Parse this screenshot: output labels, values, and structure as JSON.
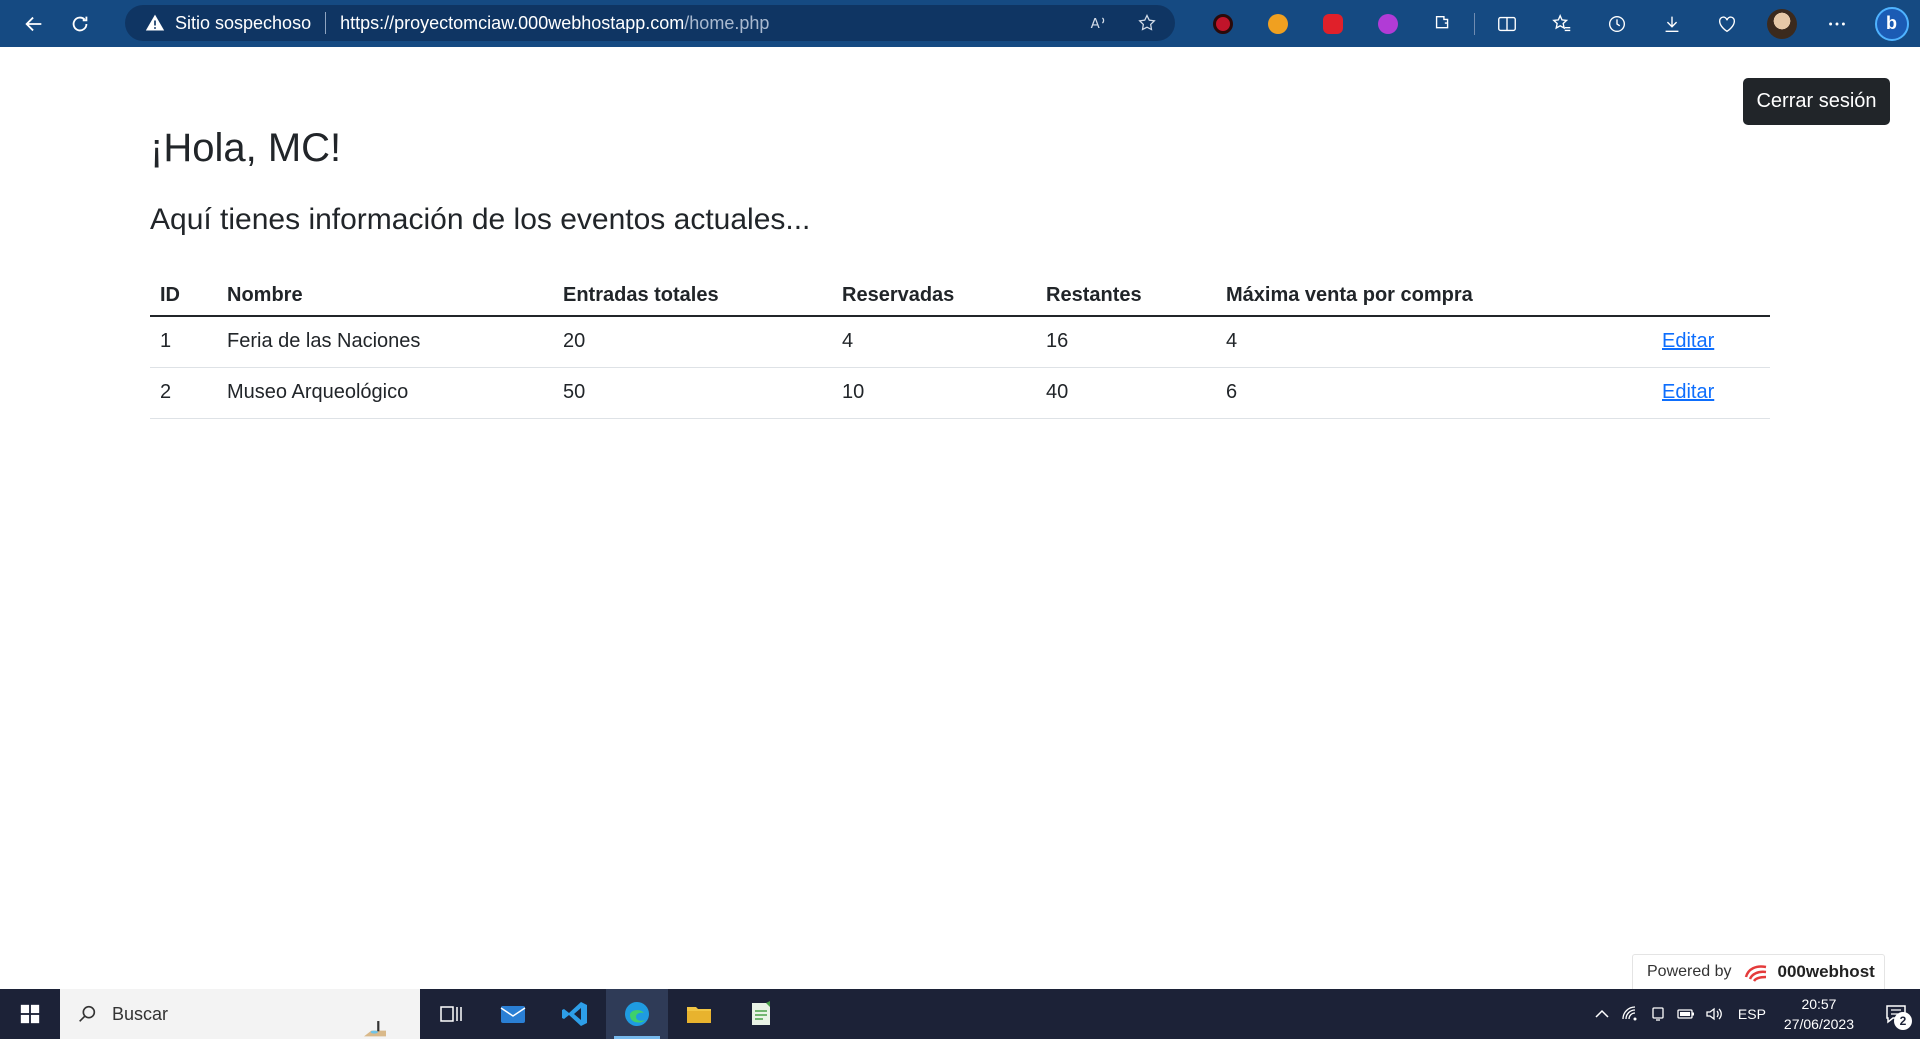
{
  "browser": {
    "security_label": "Sitio sospechoso",
    "url_host": "https://proyectomciaw.000webhostapp.com",
    "url_path": "/home.php"
  },
  "page": {
    "logout_label": "Cerrar sesión",
    "greeting": "¡Hola, MC!",
    "subtitle": "Aquí tienes información de los eventos actuales...",
    "table": {
      "headers": [
        "ID",
        "Nombre",
        "Entradas totales",
        "Reservadas",
        "Restantes",
        "Máxima venta por compra",
        ""
      ],
      "rows": [
        {
          "id": "1",
          "nombre": "Feria de las Naciones",
          "totales": "20",
          "reservadas": "4",
          "restantes": "16",
          "maxima": "4",
          "action": "Editar"
        },
        {
          "id": "2",
          "nombre": "Museo Arqueológico",
          "totales": "50",
          "reservadas": "10",
          "restantes": "40",
          "maxima": "6",
          "action": "Editar"
        }
      ]
    },
    "powered_by": "Powered by",
    "powered_brand": "000webhost"
  },
  "taskbar": {
    "search_placeholder": "Buscar",
    "language": "ESP",
    "time": "20:57",
    "date": "27/06/2023",
    "notification_count": "2"
  },
  "colors": {
    "browser_bar": "#154a82",
    "logout_button": "#212529",
    "link": "#0d6efd",
    "taskbar": "#1c2237"
  }
}
